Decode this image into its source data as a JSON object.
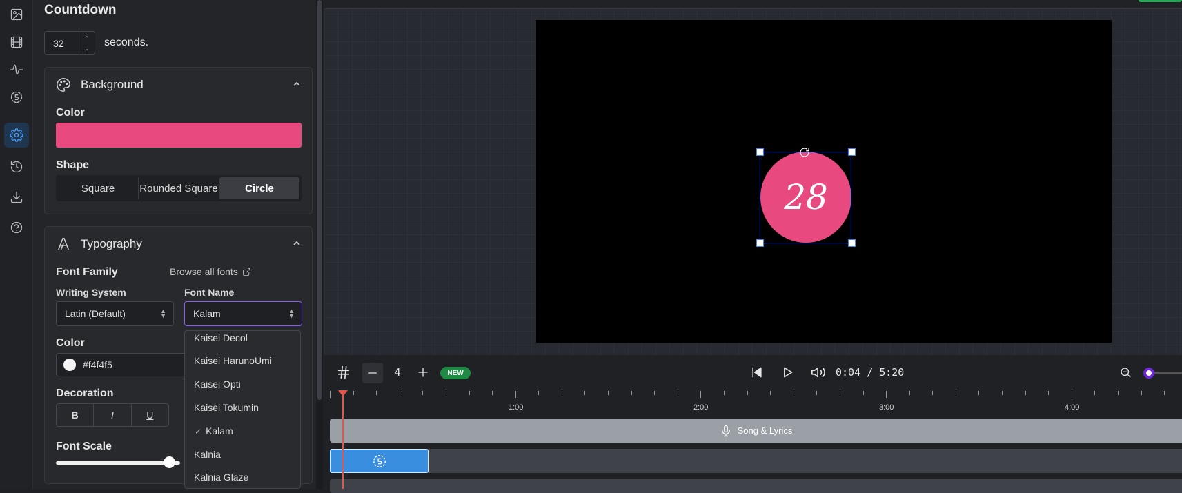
{
  "rail": {
    "icons": [
      "image-icon",
      "film-icon",
      "waveform-icon",
      "countdown-icon",
      "settings-icon",
      "history-icon",
      "download-icon",
      "help-icon"
    ],
    "active": "settings-icon"
  },
  "panel": {
    "title": "Countdown",
    "seconds_value": "32",
    "seconds_label": "seconds.",
    "background": {
      "header": "Background",
      "color_label": "Color",
      "color": "#e8497f",
      "shape_label": "Shape",
      "shapes": [
        "Square",
        "Rounded Square",
        "Circle"
      ],
      "selected_shape": "Circle"
    },
    "typography": {
      "header": "Typography",
      "font_family_label": "Font Family",
      "browse_label": "Browse all fonts",
      "writing_system_label": "Writing System",
      "writing_system_value": "Latin (Default)",
      "font_name_label": "Font Name",
      "font_name_value": "Kalam",
      "color_label": "Color",
      "color_value": "#f4f4f5",
      "decoration_label": "Decoration",
      "decoration_buttons": [
        "B",
        "I",
        "U"
      ],
      "font_scale_label": "Font Scale"
    },
    "font_dropdown": [
      "Kaisei Decol",
      "Kaisei HarunoUmi",
      "Kaisei Opti",
      "Kaisei Tokumin",
      "Kalam",
      "Kalnia",
      "Kalnia Glaze"
    ],
    "font_dropdown_selected": "Kalam"
  },
  "stage": {
    "countdown_number": "28",
    "circle_color": "#e8497f"
  },
  "controls": {
    "grid_count": "4",
    "new_badge": "NEW",
    "time": "0:04 / 5:20"
  },
  "timeline": {
    "labels": [
      "1:00",
      "2:00",
      "3:00",
      "4:00"
    ],
    "track1_label": "Song & Lyrics"
  }
}
